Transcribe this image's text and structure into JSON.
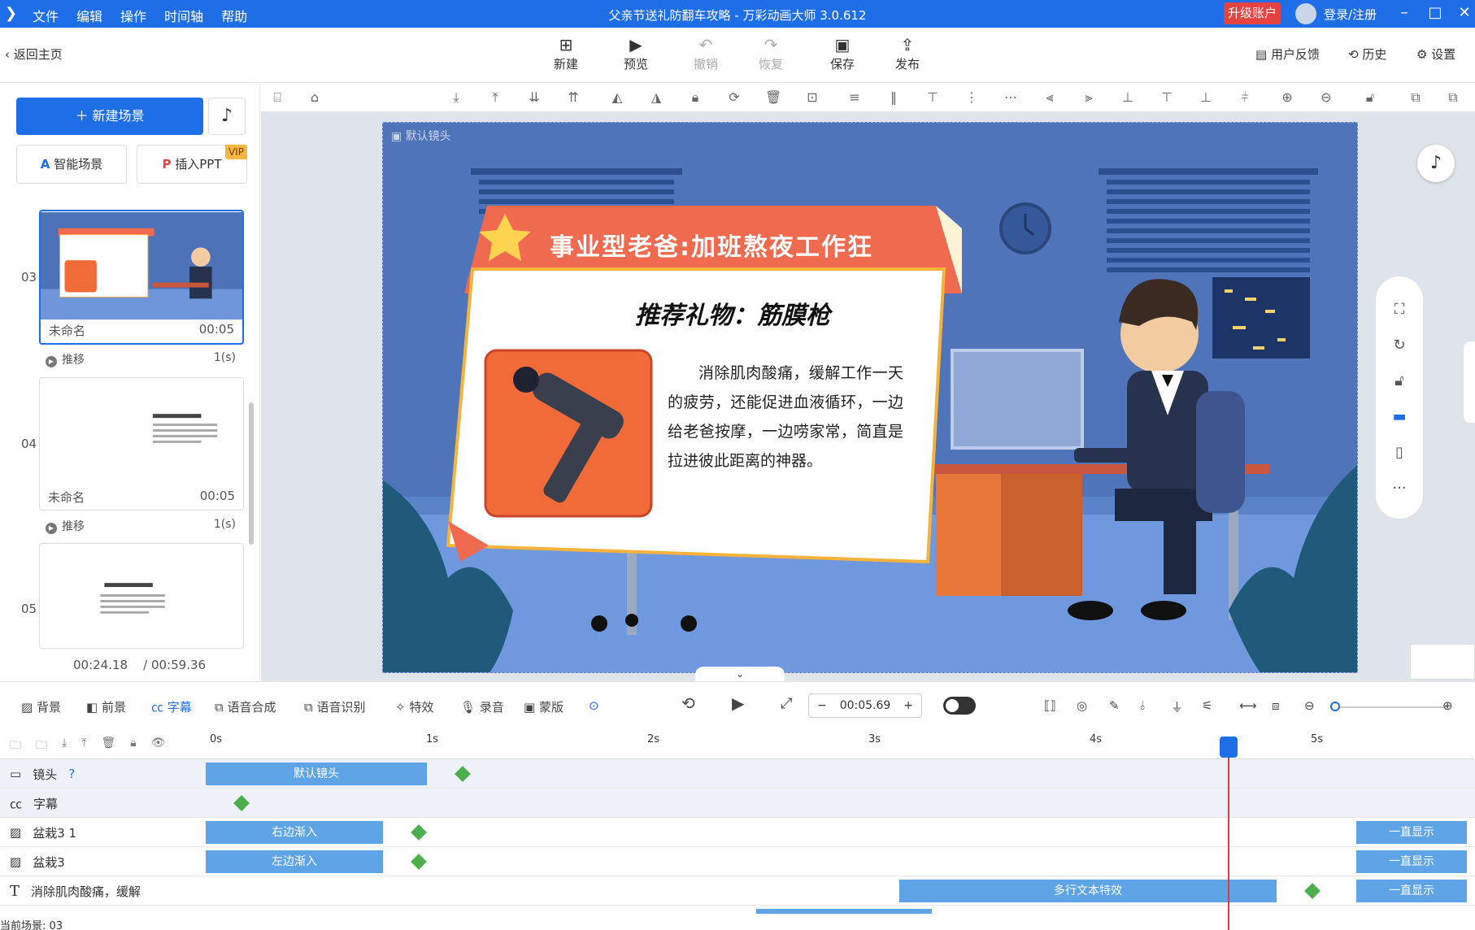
{
  "titlebar": {
    "menu": [
      "文件",
      "编辑",
      "操作",
      "时间轴",
      "帮助"
    ],
    "title": "父亲节送礼防翻车攻略 - 万彩动画大师 3.0.612",
    "upgrade": "升级账户",
    "login": "登录/注册"
  },
  "toolbar": {
    "back": "返回主页",
    "new": "新建",
    "preview": "预览",
    "undo": "撤销",
    "redo": "恢复",
    "save": "保存",
    "publish": "发布",
    "feedback": "用户反馈",
    "history": "历史",
    "settings": "设置"
  },
  "left": {
    "new_scene": "新建场景",
    "smart_scene": "智能场景",
    "insert_ppt": "插入PPT",
    "vip": "VIP",
    "scenes": [
      {
        "num": "03",
        "name": "未命名",
        "duration": "00:05",
        "transition": "推移",
        "trans_time": "1(s)"
      },
      {
        "num": "04",
        "name": "未命名",
        "duration": "00:05",
        "transition": "推移",
        "trans_time": "1(s)"
      },
      {
        "num": "05"
      }
    ],
    "current_time": "00:24.18",
    "total_time": "/ 00:59.36"
  },
  "canvas": {
    "camera_label": "默认镜头",
    "banner": "事业型老爸:加班熬夜工作狂",
    "card_title": "推荐礼物：筋膜枪",
    "card_text": "消除肌肉酸痛，缓解工作一天的疲劳，还能促进血液循环，一边给老爸按摩，一边唠家常，简直是拉进彼此距离的神器。"
  },
  "bottombar": {
    "bg": "背景",
    "fg": "前景",
    "subtitle": "字幕",
    "tts": "语音合成",
    "asr": "语音识别",
    "fx": "特效",
    "record": "录音",
    "mask": "蒙版",
    "time": "00:05.69"
  },
  "timeline": {
    "ruler": [
      "0s",
      "1s",
      "2s",
      "3s",
      "4s",
      "5s"
    ],
    "rows": [
      {
        "name": "镜头",
        "clips": [
          "默认镜头"
        ]
      },
      {
        "name": "字幕",
        "clips": []
      },
      {
        "name": "盆栽3 1",
        "clips": [
          "右边渐入",
          "一直显示"
        ]
      },
      {
        "name": "盆栽3",
        "clips": [
          "左边渐入",
          "一直显示"
        ]
      },
      {
        "name": "消除肌肉酸痛，缓解",
        "clips": [
          "多行文本特效",
          "一直显示"
        ]
      }
    ],
    "current_scene": "当前场景: 03"
  }
}
